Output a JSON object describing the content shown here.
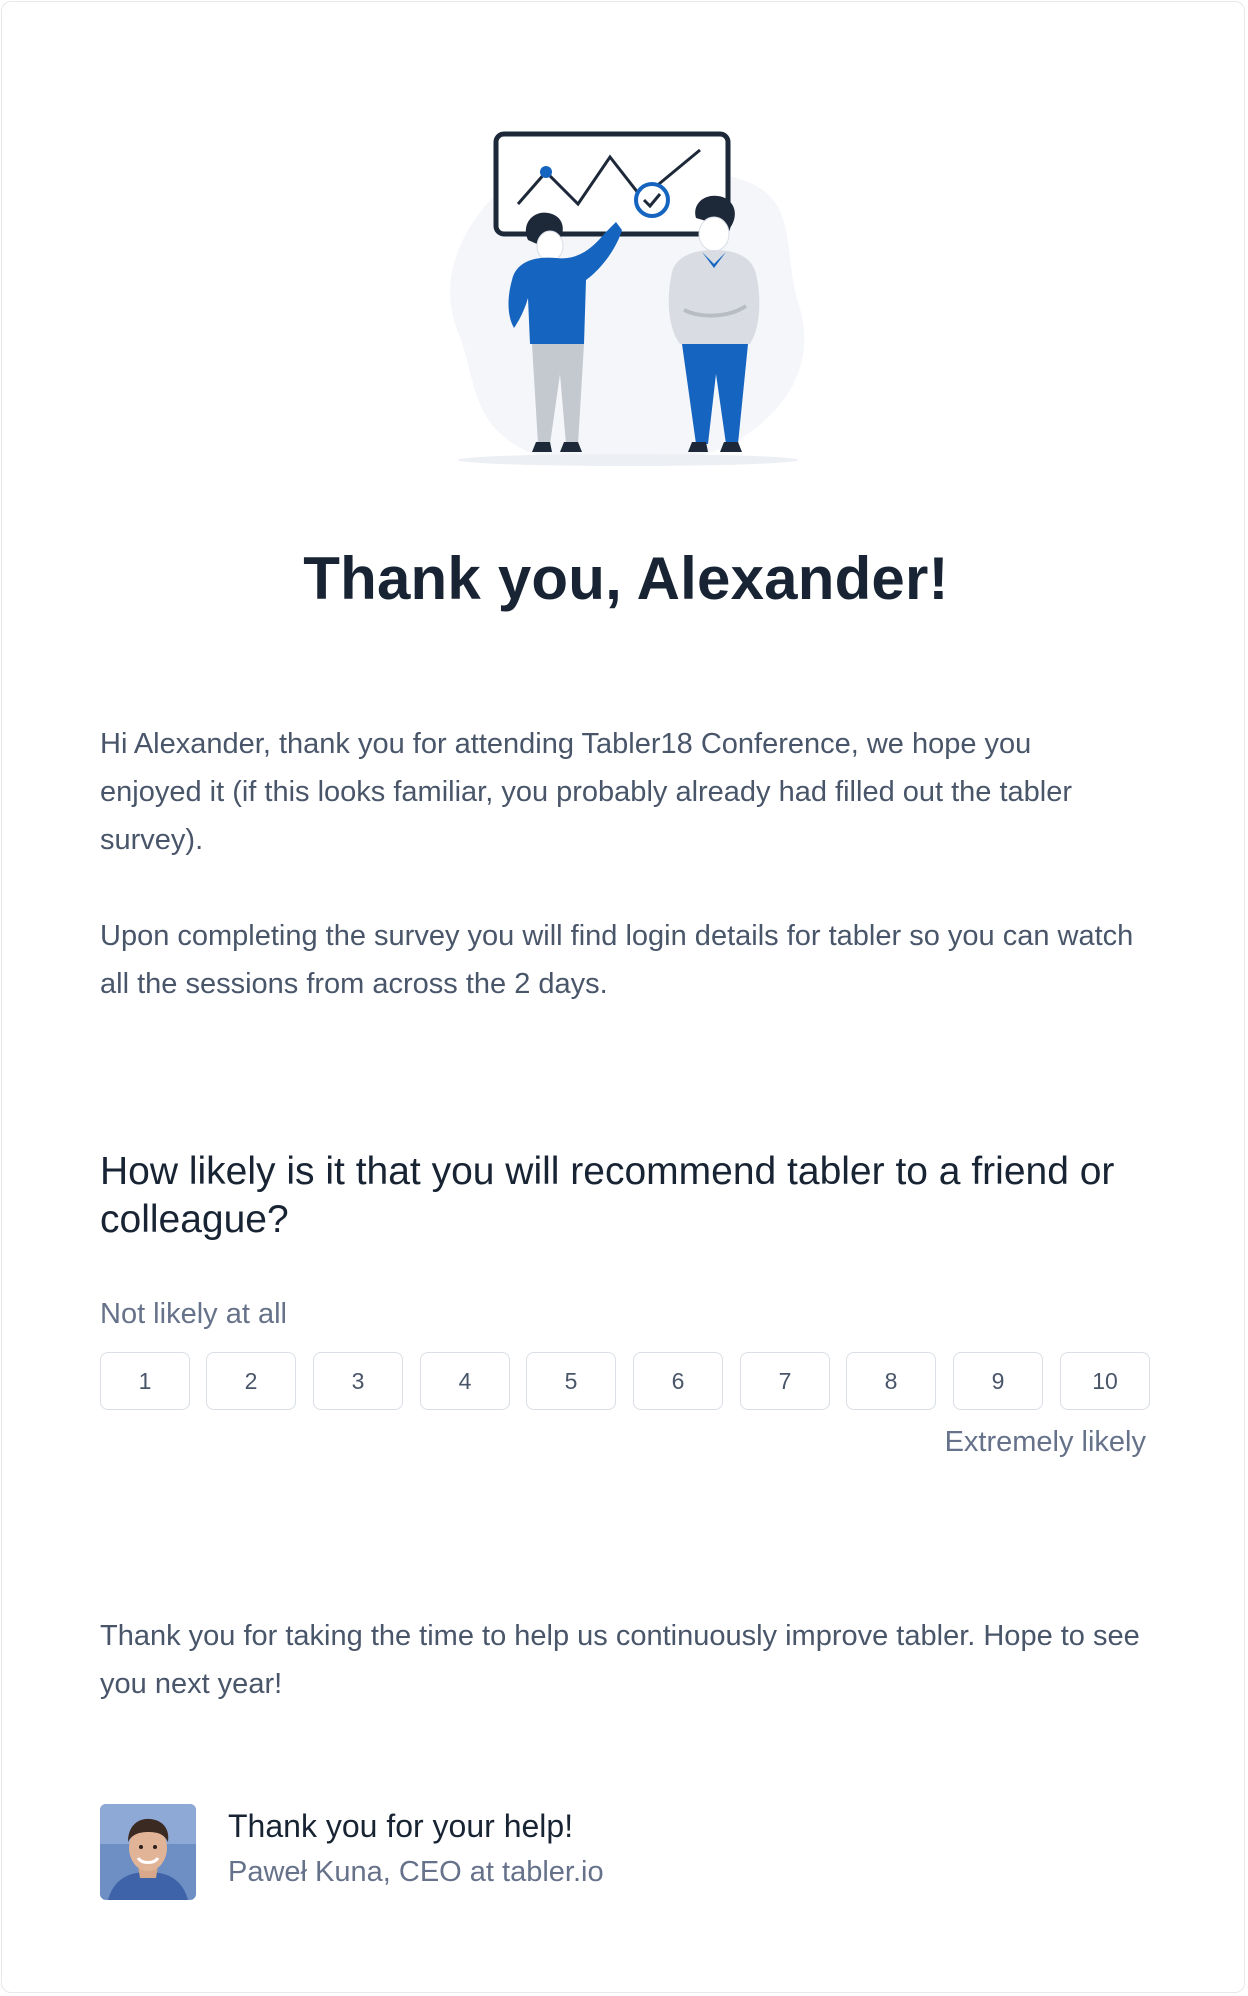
{
  "email": {
    "title": "Thank you, Alexander!",
    "intro_paragraph": "Hi Alexander, thank you for attending Tabler18 Conference, we hope you enjoyed it (if this looks familiar, you probably already had filled out the tabler survey).",
    "login_paragraph": "Upon completing the survey you will find login details for tabler so you can watch all the sessions from across the 2 days.",
    "question": "How likely is it that you will recommend tabler to a friend or colleague?",
    "scale": {
      "low_label": "Not likely at all",
      "high_label": "Extremely likely",
      "options": [
        "1",
        "2",
        "3",
        "4",
        "5",
        "6",
        "7",
        "8",
        "9",
        "10"
      ]
    },
    "closing_paragraph": "Thank you for taking the time to help us continuously improve tabler. Hope to see you next year!",
    "signature": {
      "heading": "Thank you for your help!",
      "author": "Paweł Kuna, CEO at tabler.io"
    }
  },
  "icons": {
    "illustration": "two-people-with-chart-illustration",
    "avatar": "author-avatar-photo"
  },
  "colors": {
    "brand_blue": "#1565c0",
    "title_text": "#182433",
    "body_text": "#49566a",
    "muted_text": "#66728a",
    "border": "#dadfe5"
  }
}
